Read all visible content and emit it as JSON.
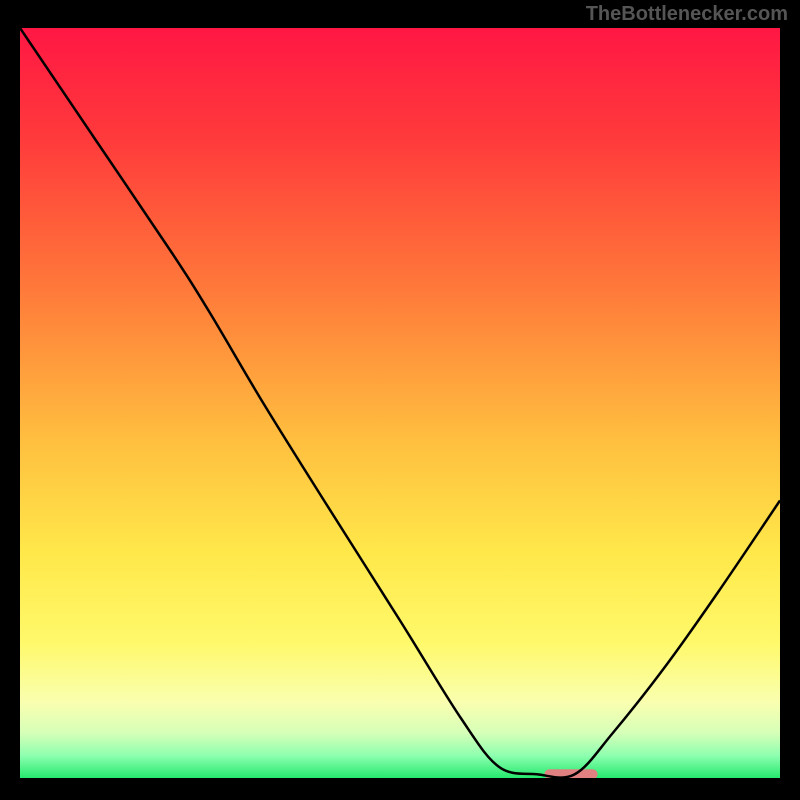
{
  "watermark": "TheBottlenecker.com",
  "chart_data": {
    "type": "line",
    "title": "",
    "xlabel": "",
    "ylabel": "",
    "xlim": [
      0,
      100
    ],
    "ylim": [
      0,
      100
    ],
    "gradient_stops": [
      {
        "offset": 0,
        "color": "#ff1744"
      },
      {
        "offset": 15,
        "color": "#ff3b3b"
      },
      {
        "offset": 35,
        "color": "#ff7a3a"
      },
      {
        "offset": 55,
        "color": "#ffbf3f"
      },
      {
        "offset": 70,
        "color": "#ffe84a"
      },
      {
        "offset": 82,
        "color": "#fff96b"
      },
      {
        "offset": 90,
        "color": "#f9ffb0"
      },
      {
        "offset": 94,
        "color": "#d6ffb8"
      },
      {
        "offset": 97,
        "color": "#8effb0"
      },
      {
        "offset": 100,
        "color": "#25e86e"
      }
    ],
    "curve": [
      {
        "x": 0,
        "y": 100
      },
      {
        "x": 10,
        "y": 85
      },
      {
        "x": 20,
        "y": 70
      },
      {
        "x": 25,
        "y": 62
      },
      {
        "x": 32,
        "y": 50
      },
      {
        "x": 40,
        "y": 37
      },
      {
        "x": 50,
        "y": 21
      },
      {
        "x": 58,
        "y": 8
      },
      {
        "x": 63,
        "y": 1.5
      },
      {
        "x": 68,
        "y": 0.5
      },
      {
        "x": 73,
        "y": 0.5
      },
      {
        "x": 78,
        "y": 6
      },
      {
        "x": 85,
        "y": 15
      },
      {
        "x": 92,
        "y": 25
      },
      {
        "x": 100,
        "y": 37
      }
    ],
    "highlight_band": {
      "x_start": 69,
      "x_end": 76,
      "y": 0.5,
      "color": "#e08080"
    }
  }
}
